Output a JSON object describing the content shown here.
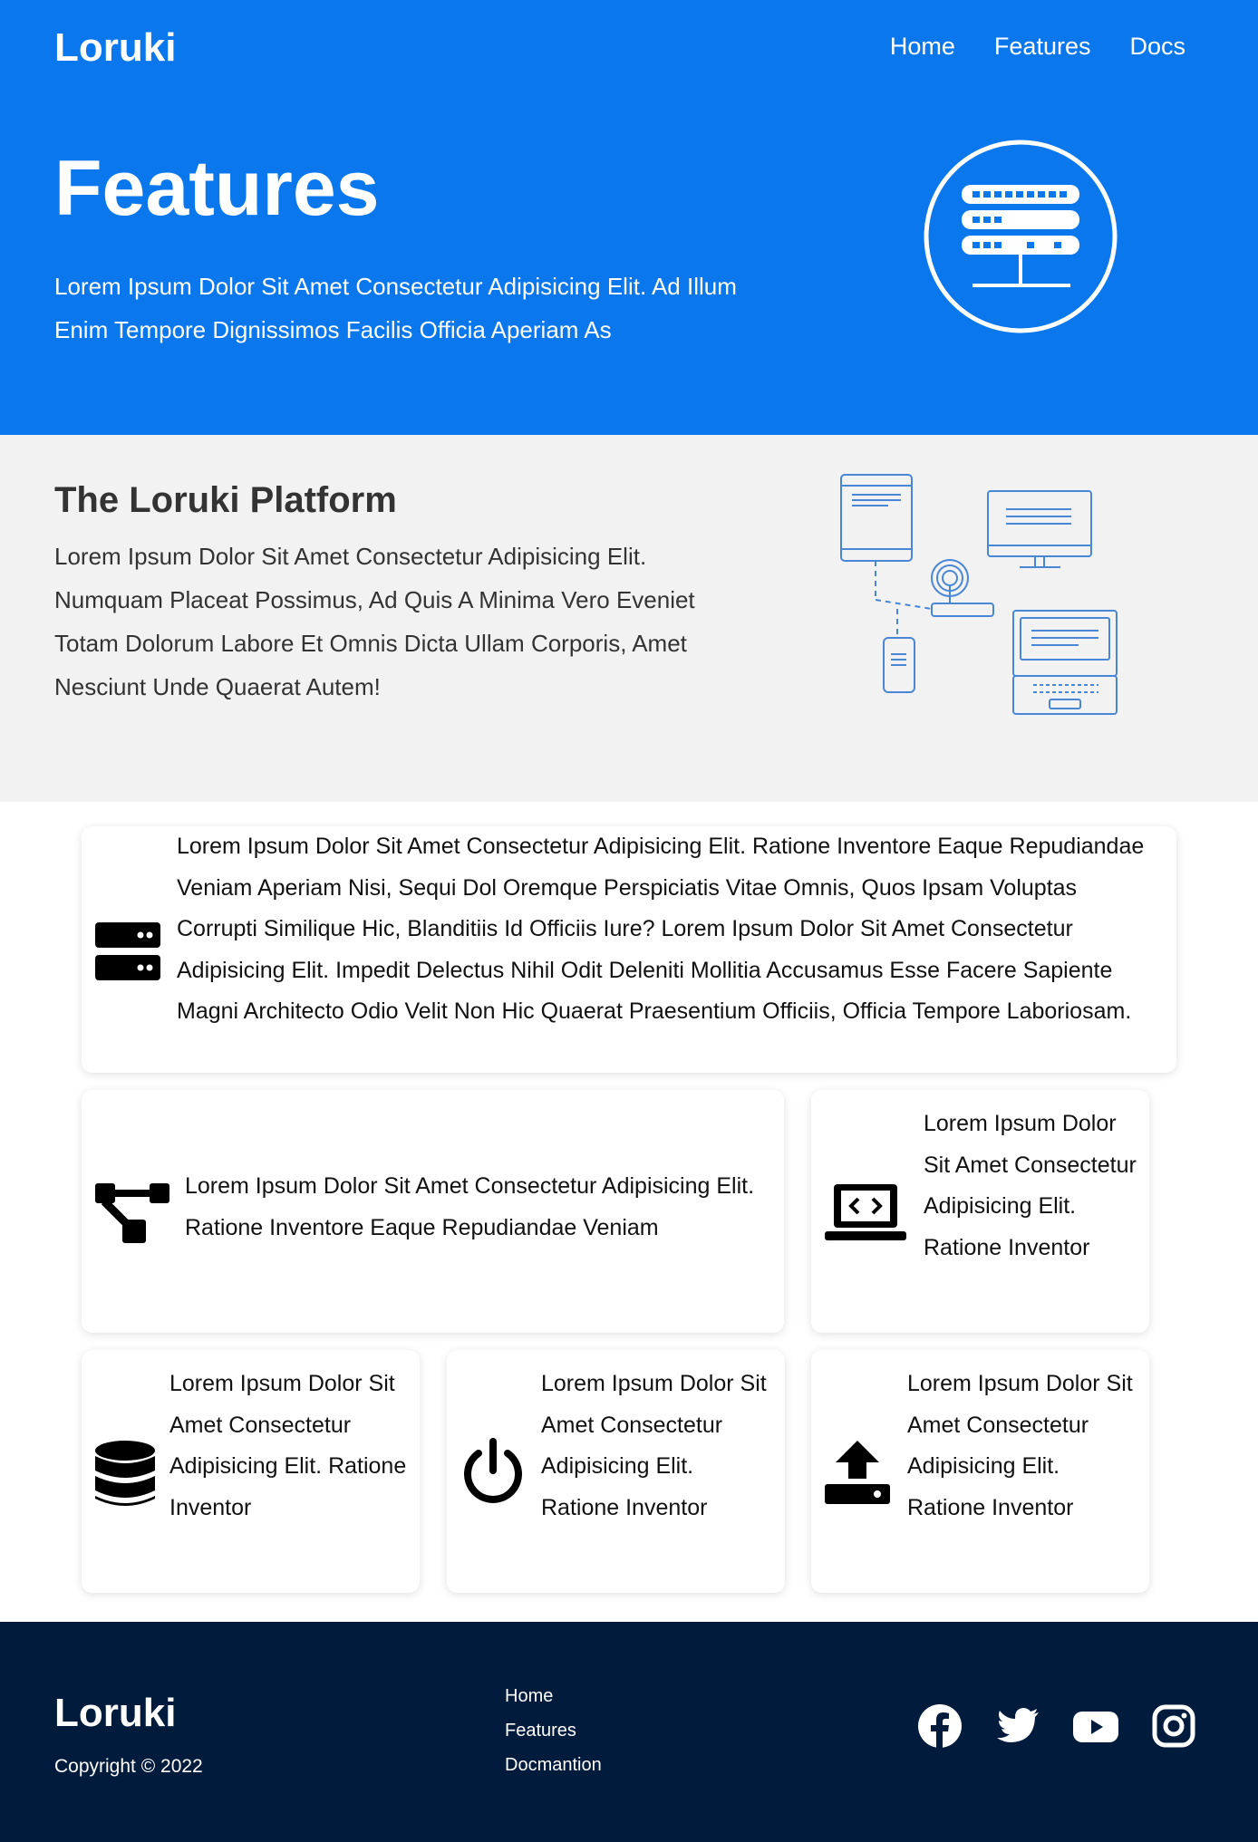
{
  "header": {
    "brand": "Loruki",
    "nav": [
      "Home",
      "Features",
      "Docs"
    ]
  },
  "hero": {
    "title": "Features",
    "description": "Lorem Ipsum Dolor Sit Amet Consectetur Adipisicing Elit. Ad Illum Enim Tempore Dignissimos Facilis Officia Aperiam As",
    "icon": "server-network-icon"
  },
  "platform": {
    "title": "The Loruki Platform",
    "text": "Lorem Ipsum Dolor Sit Amet Consectetur Adipisicing Elit. Numquam Placeat Possimus, Ad Quis A Minima Vero Eveniet Totam Dolorum Labore Et Omnis Dicta Ullam Corporis, Amet Nesciunt Unde Quaerat Autem!",
    "illustration": "connected-devices-icon"
  },
  "cards": [
    {
      "icon": "server-icon",
      "text": "Lorem Ipsum Dolor Sit Amet Consectetur Adipisicing Elit. Ratione Inventore Eaque Repudiandae Veniam Aperiam Nisi, Sequi Dol Oremque Perspiciatis Vitae Omnis, Quos Ipsam Voluptas Corrupti Similique Hic, Blanditiis Id Officiis Iure? Lorem Ipsum Dolor Sit Amet Consectetur Adipisicing Elit. Impedit Delectus Nihil Odit Deleniti Mollitia Accusamus Esse Facere Sapiente Magni Architecto Odio Velit Non Hic Quaerat Praesentium Officiis, Officia Tempore Laboriosam."
    },
    {
      "icon": "network-wired-icon",
      "text": "Lorem Ipsum Dolor Sit Amet Consectetur Adipisicing Elit. Ratione Inventore Eaque Repudiandae Veniam"
    },
    {
      "icon": "laptop-code-icon",
      "text": "Lorem Ipsum Dolor Sit Amet Consectetur Adipisicing Elit. Ratione Inventor"
    },
    {
      "icon": "database-icon",
      "text": "Lorem Ipsum Dolor Sit Amet Consectetur Adipisicing Elit. Ratione Inventor"
    },
    {
      "icon": "power-off-icon",
      "text": "Lorem Ipsum Dolor Sit Amet Consectetur Adipisicing Elit. Ratione Inventor"
    },
    {
      "icon": "upload-icon",
      "text": "Lorem Ipsum Dolor Sit Amet Consectetur Adipisicing Elit. Ratione Inventor"
    }
  ],
  "footer": {
    "brand": "Loruki",
    "copyright": "Copyright © 2022",
    "links": [
      "Home",
      "Features",
      "Docmantion"
    ],
    "socials": [
      "facebook-icon",
      "twitter-icon",
      "youtube-icon",
      "instagram-icon"
    ]
  },
  "colors": {
    "primary": "#0a77ec",
    "light_bg": "#f2f2f2",
    "footer_bg": "#011b3d",
    "illustration_line": "#4a86d6"
  }
}
